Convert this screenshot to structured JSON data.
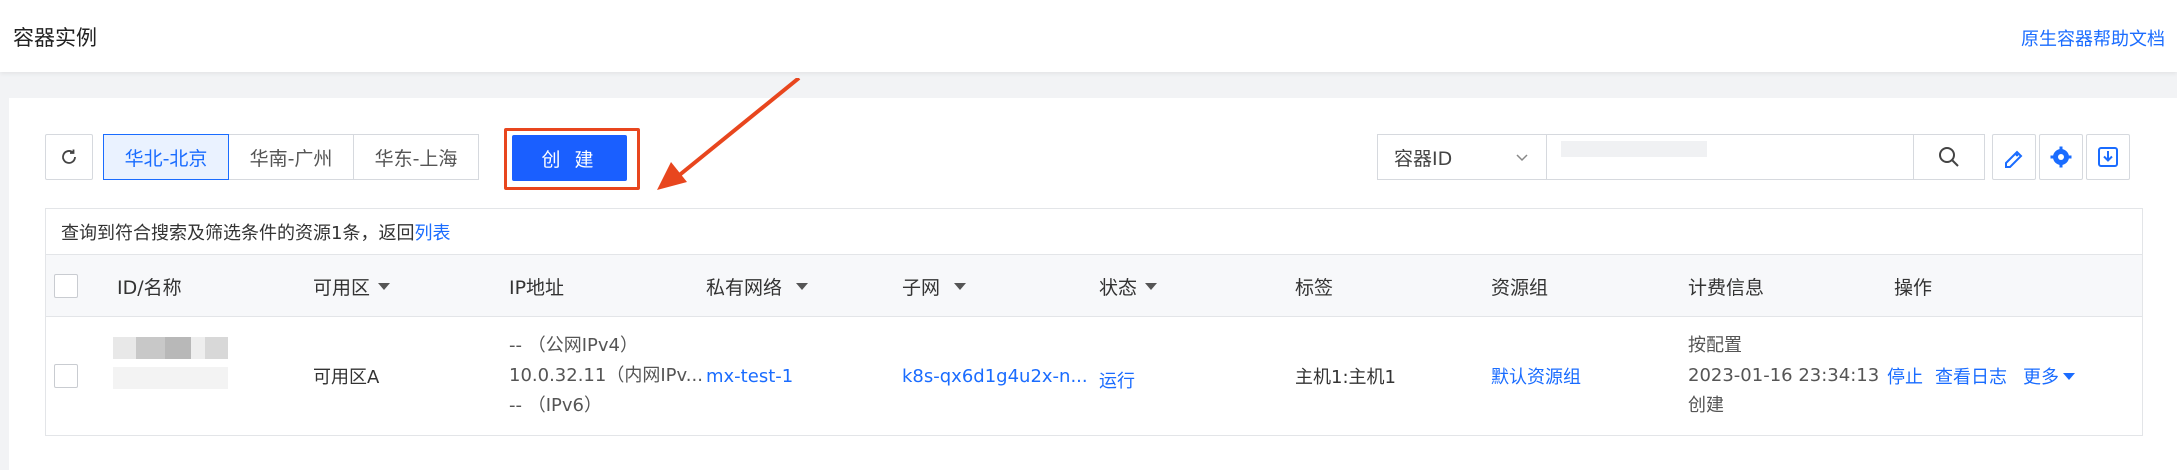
{
  "header": {
    "title": "容器实例",
    "help_link": "原生容器帮助文档"
  },
  "toolbar": {
    "regions": [
      "华北-北京",
      "华南-广州",
      "华东-上海"
    ],
    "active_region": "华北-北京",
    "create_label": "创 建",
    "search_field": "容器ID"
  },
  "summary": {
    "text": "查询到符合搜索及筛选条件的资源1条，返回",
    "link": "列表"
  },
  "table": {
    "columns": [
      "ID/名称",
      "可用区",
      "IP地址",
      "私有网络",
      "子网",
      "状态",
      "标签",
      "资源组",
      "计费信息",
      "操作"
    ],
    "row": {
      "zone": "可用区A",
      "ip_public": "-- （公网IPv4）",
      "ip_private": "10.0.32.11（内网IPv...",
      "ip_v6": "-- （IPv6）",
      "vpc": "mx-test-1",
      "subnet": "k8s-qx6d1g4u2x-n...",
      "status": "运行",
      "tags": "主机1:主机1",
      "resource_group": "默认资源组",
      "billing_mode": "按配置",
      "billing_time": "2023-01-16 23:34:13",
      "billing_suffix": "创建",
      "actions": [
        "停止",
        "查看日志",
        "更多"
      ]
    }
  },
  "colors": {
    "accent": "#1a6cff",
    "create_bg": "#1a5fff",
    "highlight": "#e8461e"
  }
}
